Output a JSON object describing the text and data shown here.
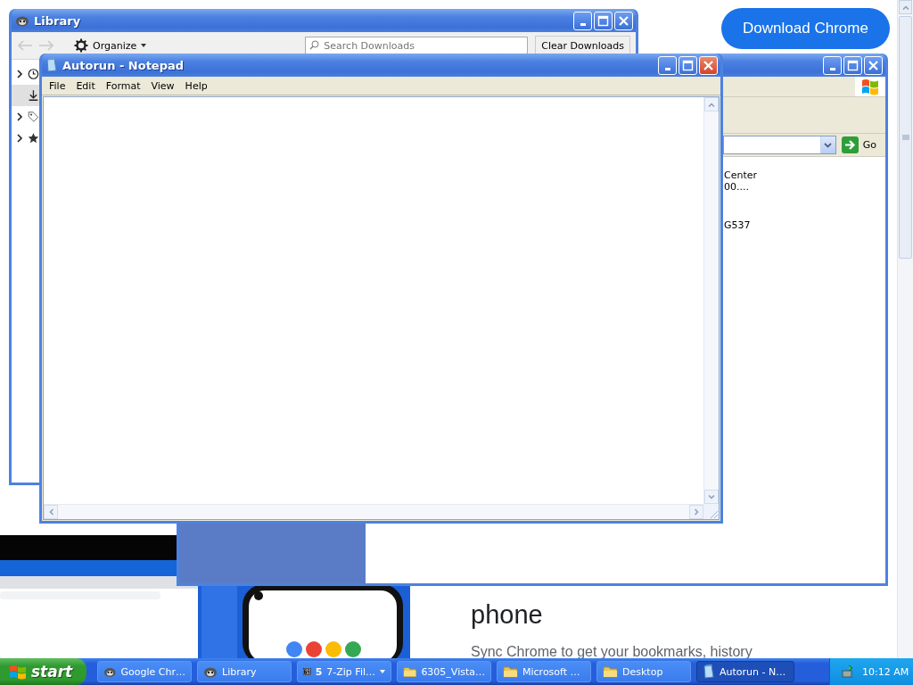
{
  "browser_page": {
    "download_button": "Download Chrome",
    "heading": "phone",
    "body_text": "Sync Chrome to get your bookmarks, history"
  },
  "background_window": {
    "active": false,
    "go_button": "Go",
    "content_lines": [
      "Center",
      "00....",
      "G537"
    ]
  },
  "library_window": {
    "title": "Library",
    "active": false,
    "back": {
      "disabled": true
    },
    "forward": {
      "disabled": true
    },
    "organize_button": "Organize",
    "search": {
      "placeholder": "Search Downloads"
    },
    "clear_button": "Clear Downloads",
    "sidebar": {
      "items": [
        {
          "kind": "clock",
          "expandable": true,
          "selected": false
        },
        {
          "kind": "download",
          "expandable": false,
          "selected": true
        },
        {
          "kind": "tag",
          "expandable": true,
          "selected": false
        },
        {
          "kind": "star",
          "expandable": true,
          "selected": false
        }
      ]
    }
  },
  "notepad": {
    "title": "Autorun - Notepad",
    "active": true,
    "menu": [
      "File",
      "Edit",
      "Format",
      "View",
      "Help"
    ]
  },
  "taskbar": {
    "start": "start",
    "tasks": [
      {
        "kind": "app",
        "label": "Google Chr…",
        "selected": false
      },
      {
        "kind": "app",
        "label": "Library",
        "selected": false
      },
      {
        "kind": "archive",
        "count": "5",
        "label": "7-Zip Fil…",
        "selected": false
      },
      {
        "kind": "folder",
        "label": "6305_Vista…",
        "selected": false
      },
      {
        "kind": "folder",
        "label": "Microsoft …",
        "selected": false
      },
      {
        "kind": "folder",
        "label": "Desktop",
        "selected": false
      },
      {
        "kind": "page",
        "label": "Autorun - N…",
        "selected": true
      }
    ],
    "clock": "10:12 AM"
  }
}
